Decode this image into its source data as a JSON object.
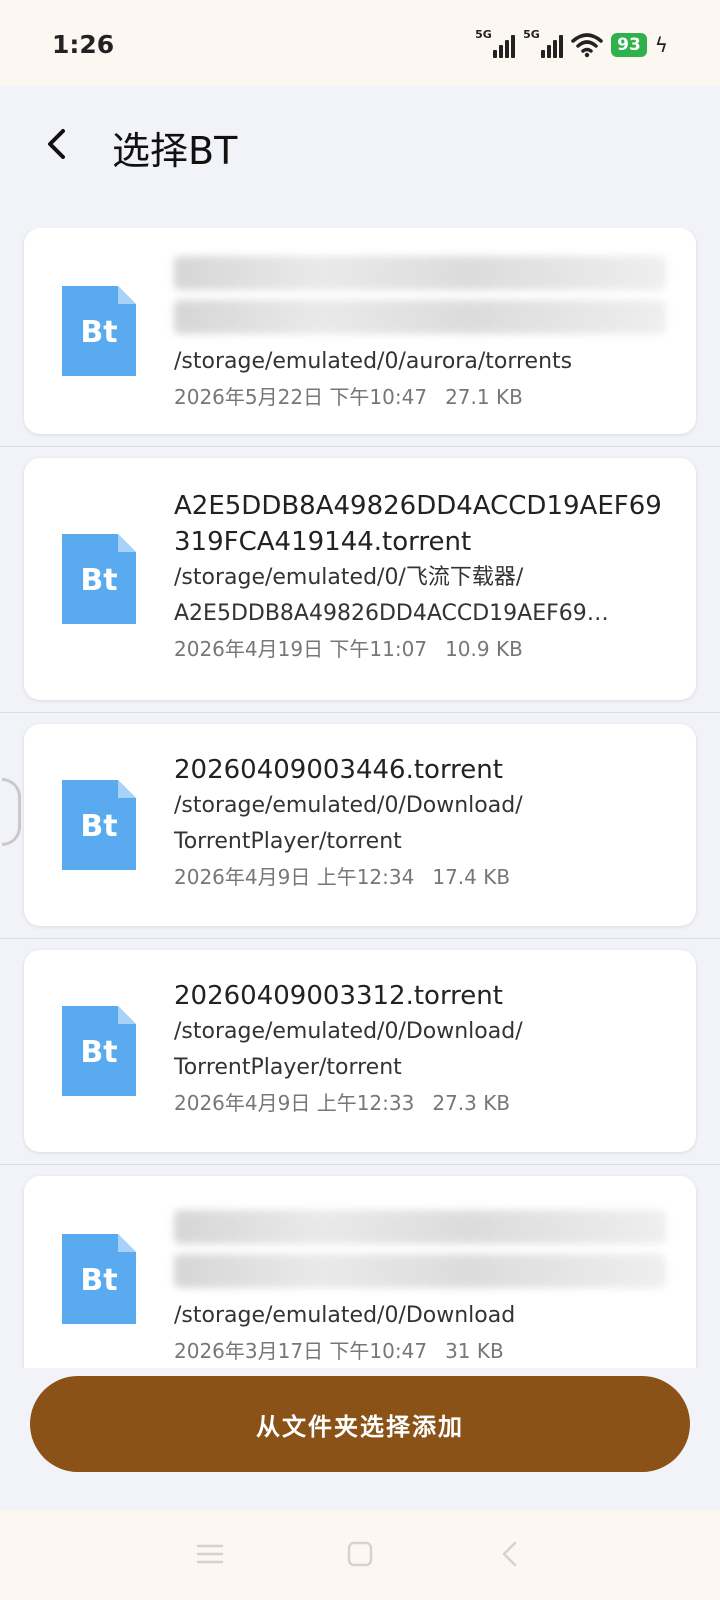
{
  "status_bar": {
    "time": "1:26",
    "signal1_label": "5G",
    "signal2_label": "5G",
    "battery": "93",
    "battery_color": "#2fb24c"
  },
  "header": {
    "title": "选择BT"
  },
  "files": [
    {
      "name_blurred": true,
      "path": "/storage/emulated/0/aurora/torrents",
      "date": "2026年5月22日 下午10:47",
      "size": "27.1 KB",
      "icon_label": "Bt"
    },
    {
      "name": "A2E5DDB8A49826DD4ACCD19AEF69319FCA419144.torrent",
      "path": "/storage/emulated/0/飞流下载器/",
      "path2": "A2E5DDB8A49826DD4ACCD19AEF69…",
      "date": "2026年4月19日 下午11:07",
      "size": "10.9 KB",
      "icon_label": "Bt"
    },
    {
      "name": "20260409003446.torrent",
      "path": "/storage/emulated/0/Download/",
      "path2": "TorrentPlayer/torrent",
      "date": "2026年4月9日 上午12:34",
      "size": "17.4 KB",
      "icon_label": "Bt"
    },
    {
      "name": "20260409003312.torrent",
      "path": "/storage/emulated/0/Download/",
      "path2": "TorrentPlayer/torrent",
      "date": "2026年4月9日 上午12:33",
      "size": "27.3 KB",
      "icon_label": "Bt"
    },
    {
      "name_blurred": true,
      "path": "/storage/emulated/0/Download",
      "date": "2026年3月17日 下午10:47",
      "size": "31 KB",
      "icon_label": "Bt"
    }
  ],
  "add_button_label": "从文件夹选择添加",
  "accent_color": "#8a5217",
  "icon_color": "#5aaaf0"
}
